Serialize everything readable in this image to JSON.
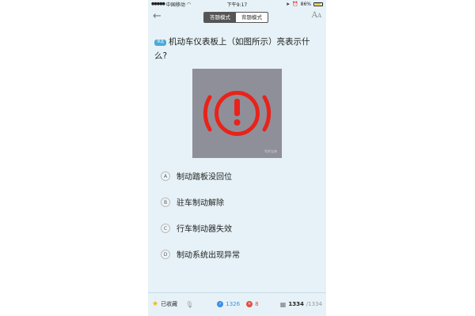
{
  "status_bar": {
    "carrier": "中国移动",
    "time": "下午9:17",
    "battery": "86%",
    "battery_level": 0.86
  },
  "header": {
    "back_icon": "back-arrow-icon",
    "modes": [
      "答题模式",
      "背题模式"
    ],
    "active_mode": 0,
    "font_icon": "font-size-icon"
  },
  "question": {
    "badge": "单选",
    "text": "机动车仪表板上（如图所示）亮表示什么?"
  },
  "image": {
    "watermark": "驾考宝典",
    "symbol_color": "#e8231a"
  },
  "options": [
    {
      "letter": "A",
      "text": "制动踏板没回位"
    },
    {
      "letter": "B",
      "text": "驻车制动解除"
    },
    {
      "letter": "C",
      "text": "行车制动器失效"
    },
    {
      "letter": "D",
      "text": "制动系统出现异常"
    }
  ],
  "bottom_bar": {
    "favorite_label": "已收藏",
    "correct_count": "1326",
    "wrong_count": "8",
    "current": "1334",
    "total": "/1334"
  }
}
